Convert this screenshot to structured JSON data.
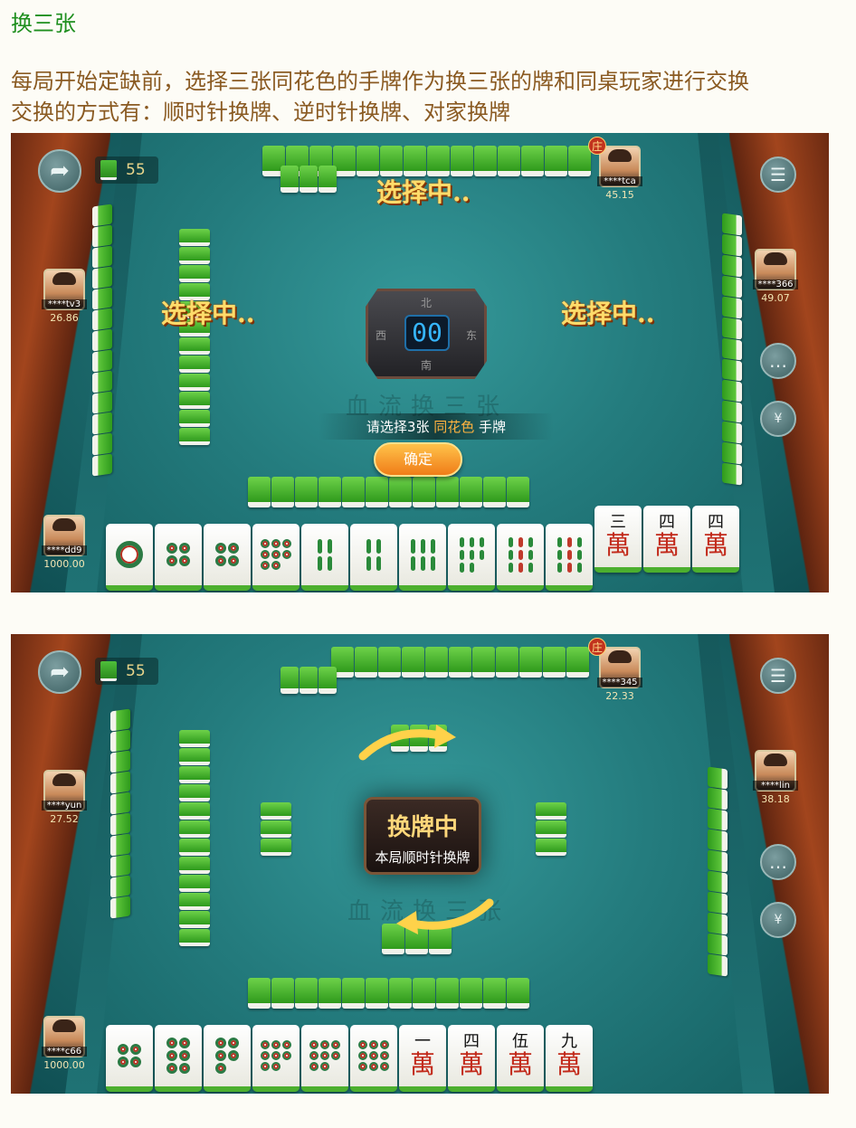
{
  "title": "换三张",
  "description_line1": "每局开始定缺前，选择三张同花色的手牌作为换三张的牌和同桌玩家进行交换",
  "description_line2": "交换的方式有：顺时针换牌、逆时针换牌、对家换牌",
  "colors": {
    "title": "#1f8f1f",
    "description": "#8a5a22",
    "felt": "#247c7e",
    "accent": "#ffb340"
  },
  "screen1": {
    "remaining_tiles": "55",
    "dealer_mark": "庄",
    "players": {
      "top": {
        "name": "****tca",
        "score": "45.15"
      },
      "left": {
        "name": "****tv3",
        "score": "26.86"
      },
      "right": {
        "name": "****366",
        "score": "49.07"
      },
      "self": {
        "name": "****dd9",
        "score": "1000.00"
      }
    },
    "status_text": "选择中..",
    "compass": {
      "north": "北",
      "east": "东",
      "south": "南",
      "west": "西",
      "timer": "00"
    },
    "watermark": "血流换三张",
    "prompt_prefix": "请选择3张",
    "prompt_highlight": "同花色",
    "prompt_suffix": "手牌",
    "confirm_label": "确定",
    "hand": [
      {
        "kind": "dot",
        "count": 1
      },
      {
        "kind": "dot",
        "count": 4
      },
      {
        "kind": "dot",
        "count": 4
      },
      {
        "kind": "dot",
        "count": 8
      },
      {
        "kind": "bam",
        "count": 4
      },
      {
        "kind": "bam",
        "count": 4
      },
      {
        "kind": "bam",
        "count": 6
      },
      {
        "kind": "bam",
        "count": 8
      },
      {
        "kind": "bam",
        "count": 9
      },
      {
        "kind": "bam",
        "count": 9
      },
      {
        "kind": "wan",
        "num": "三",
        "char": "萬"
      },
      {
        "kind": "wan",
        "num": "四",
        "char": "萬"
      },
      {
        "kind": "wan",
        "num": "四",
        "char": "萬"
      }
    ]
  },
  "screen2": {
    "remaining_tiles": "55",
    "dealer_mark": "庄",
    "players": {
      "top": {
        "name": "****345",
        "score": "22.33"
      },
      "left": {
        "name": "****yun",
        "score": "27.52"
      },
      "right": {
        "name": "****lin",
        "score": "38.18"
      },
      "self": {
        "name": "****c66",
        "score": "1000.00"
      }
    },
    "swap_title": "换牌中",
    "swap_subtitle": "本局顺时针换牌",
    "watermark": "血流换三张",
    "hand": [
      {
        "kind": "dot",
        "count": 4
      },
      {
        "kind": "dot",
        "count": 6
      },
      {
        "kind": "dot",
        "count": 5
      },
      {
        "kind": "dot",
        "count": 8
      },
      {
        "kind": "dot",
        "count": 8
      },
      {
        "kind": "dot",
        "count": 9
      },
      {
        "kind": "wan",
        "num": "一",
        "char": "萬"
      },
      {
        "kind": "wan",
        "num": "四",
        "char": "萬"
      },
      {
        "kind": "wan",
        "num": "伍",
        "char": "萬"
      },
      {
        "kind": "wan",
        "num": "九",
        "char": "萬"
      }
    ]
  },
  "icons": {
    "back": "back-arrow-icon",
    "menu": "menu-icon",
    "chat": "chat-icon",
    "yuan": "yuan-icon",
    "tiles": "tile-stack-icon"
  }
}
